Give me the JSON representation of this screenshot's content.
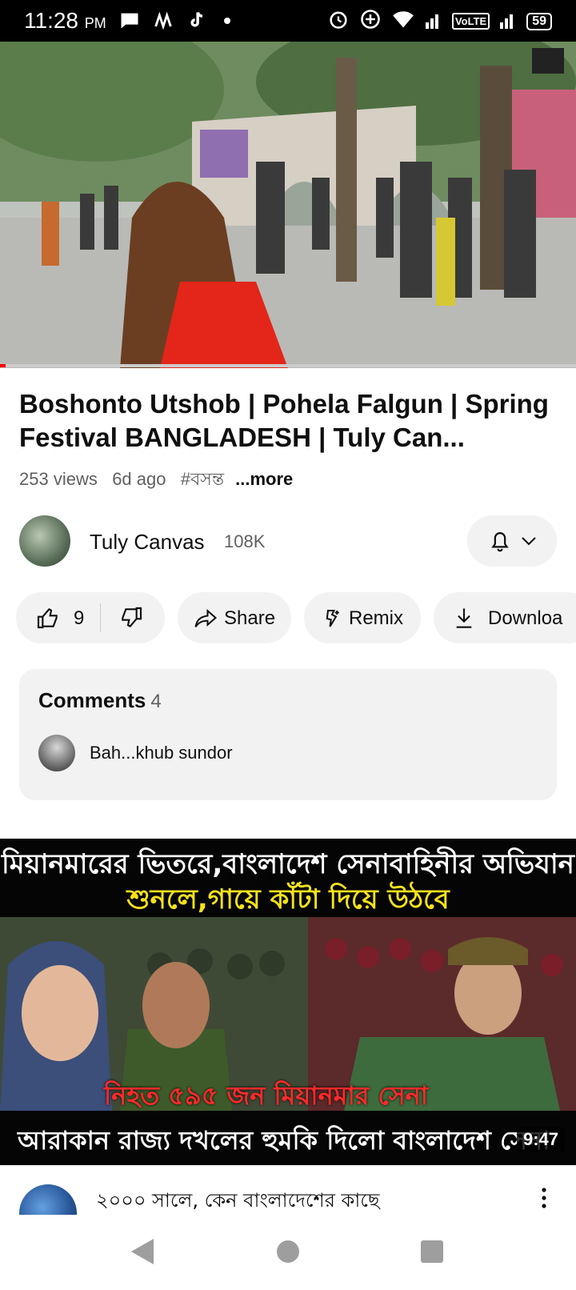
{
  "status_bar": {
    "time": "11:28",
    "ampm": "PM",
    "network": "VoLTE",
    "battery": "59"
  },
  "video": {
    "title": "Boshonto Utshob | Pohela Falgun | Spring Festival BANGLADESH | Tuly Can...",
    "views": "253 views",
    "age": "6d ago",
    "hashtag": "#বসন্ত",
    "more_label": "...more",
    "progress_fraction": 0.01
  },
  "channel": {
    "name": "Tuly Canvas",
    "subscribers": "108K"
  },
  "actions": {
    "likes": "9",
    "share_label": "Share",
    "remix_label": "Remix",
    "download_label": "Downloa"
  },
  "comments": {
    "header": "Comments",
    "count": "4",
    "top_comment": "Bah...khub sundor"
  },
  "recommended": {
    "headline_1": "মিয়ানমারের ভিতরে,বাংলাদেশ সেনাবাহিনীর অভিযান",
    "headline_2": "শুনলে,গায়ে কাঁটা দিয়ে উঠবে",
    "overlay": "নিহত ৫৯৫ জন মিয়ানমার সেনা",
    "banner": "আরাকান রাজ্য দখলের হুমকি দিলো বাংলাদেশ সেনা",
    "duration": "9:47"
  },
  "next_video": {
    "title": "২০০০ সালে, কেন বাংলাদেশের কাছে"
  },
  "colors": {
    "accent_red": "#ff0000",
    "pill_bg": "#f2f2f2",
    "thumb_yellow": "#f5e11a"
  }
}
